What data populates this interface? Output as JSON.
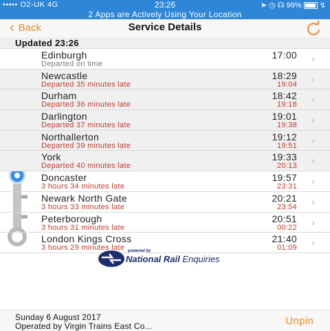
{
  "status_bar": {
    "carrier": "O2-UK  4G",
    "time": "23:26",
    "battery": "99%",
    "icons": [
      "signal-icon",
      "location-icon",
      "alarm-icon",
      "headphones-icon",
      "bluetooth-icon",
      "battery-icon"
    ]
  },
  "location_banner": "2 Apps are Actively Using Your Location",
  "nav": {
    "back_label": "Back",
    "title": "Service Details",
    "accent": "#f08a24"
  },
  "updated": "Updated 23:26",
  "stops": [
    {
      "name": "Edinburgh",
      "status": "Departed on time",
      "scheduled": "17:00",
      "expected": "",
      "state": "past"
    },
    {
      "name": "Newcastle",
      "status": "Departed 35 minutes late",
      "scheduled": "18:29",
      "expected": "19:04",
      "state": "past"
    },
    {
      "name": "Durham",
      "status": "Departed 36 minutes late",
      "scheduled": "18:42",
      "expected": "19:18",
      "state": "past"
    },
    {
      "name": "Darlington",
      "status": "Departed 37 minutes late",
      "scheduled": "19:01",
      "expected": "19:38",
      "state": "past"
    },
    {
      "name": "Northallerton",
      "status": "Departed 39 minutes late",
      "scheduled": "19:12",
      "expected": "19:51",
      "state": "past"
    },
    {
      "name": "York",
      "status": "Departed 40 minutes late",
      "scheduled": "19:33",
      "expected": "20:13",
      "state": "past"
    },
    {
      "name": "Doncaster",
      "status": "3 hours 34 minutes late",
      "scheduled": "19:57",
      "expected": "23:31",
      "state": "current"
    },
    {
      "name": "Newark North Gate",
      "status": "3 hours 33 minutes late",
      "scheduled": "20:21",
      "expected": "23:54",
      "state": "future"
    },
    {
      "name": "Peterborough",
      "status": "3 hours 31 minutes late",
      "scheduled": "20:51",
      "expected": "00:22",
      "state": "future"
    },
    {
      "name": "London Kings Cross",
      "status": "3 hours 29 minutes late",
      "scheduled": "21:40",
      "expected": "01:09",
      "state": "future"
    }
  ],
  "branding": {
    "powered_by": "powered by",
    "name_bold": "National Rail",
    "name_rest": " Enquiries"
  },
  "footer": {
    "date": "Sunday 6 August 2017",
    "operator": "Operated by Virgin Trains East Co...",
    "unpin_label": "Unpin"
  },
  "colors": {
    "status_bar": "#2f86d6",
    "late_text": "#c0392b",
    "current_stop": "#3b8fe0",
    "track": "#b9b9b9"
  }
}
